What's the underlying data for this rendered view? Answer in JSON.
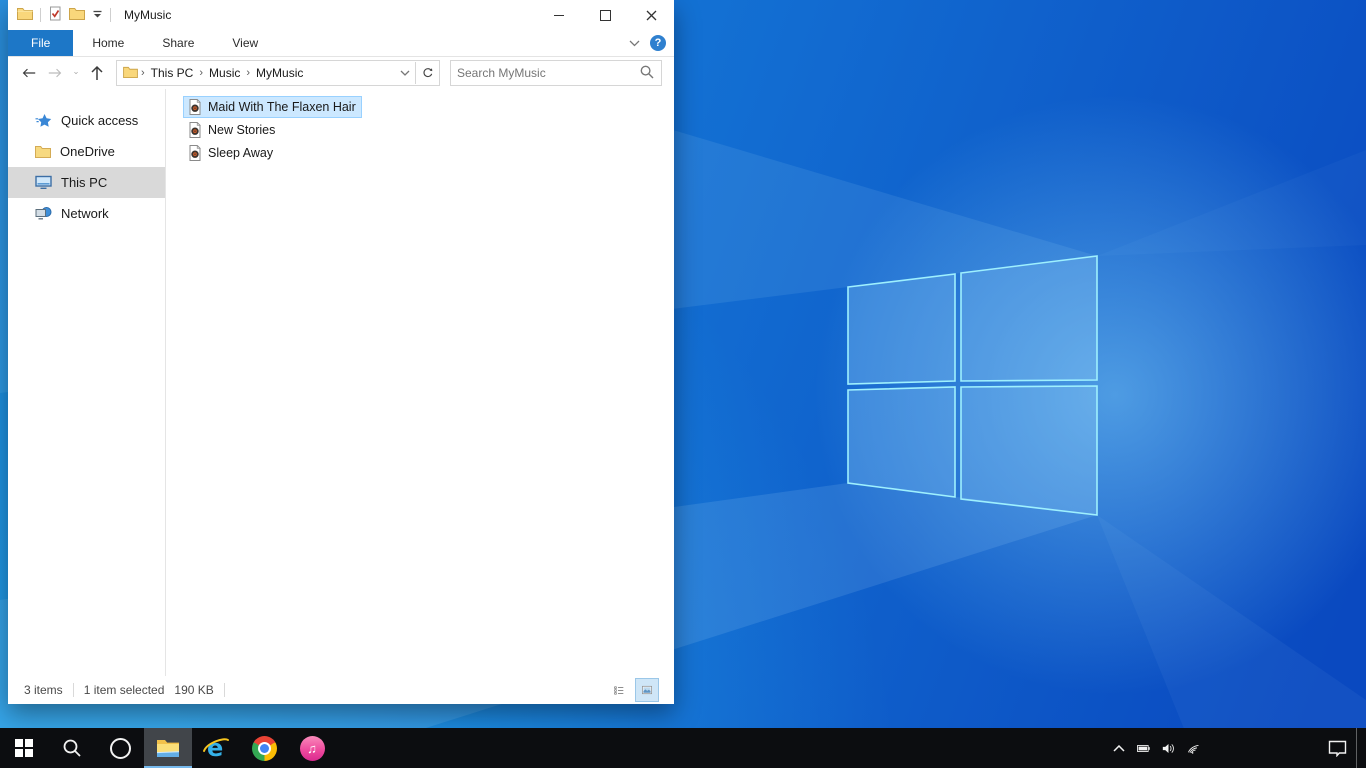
{
  "window": {
    "title": "MyMusic",
    "quick_access_toolbar": {
      "icons": [
        "explorer-folder",
        "properties",
        "new-folder",
        "customize-dropdown"
      ]
    },
    "caption_controls": [
      "minimize",
      "maximize",
      "close"
    ],
    "tabs": [
      {
        "label": "File",
        "active": true
      },
      {
        "label": "Home",
        "active": false
      },
      {
        "label": "Share",
        "active": false
      },
      {
        "label": "View",
        "active": false
      }
    ],
    "ribbon": {
      "collapse_icon": "chevron-down",
      "help_label": "?"
    },
    "address": {
      "crumbs": [
        "This PC",
        "Music",
        "MyMusic"
      ],
      "separator": "›",
      "icons": [
        "back",
        "forward",
        "recent-locations-dropdown",
        "up",
        "folder",
        "address-dropdown",
        "refresh"
      ]
    },
    "search": {
      "placeholder": "Search MyMusic",
      "icon": "magnifier"
    },
    "nav_items": [
      {
        "label": "Quick access",
        "icon": "quick-access-star",
        "selected": false
      },
      {
        "label": "OneDrive",
        "icon": "folder",
        "selected": false
      },
      {
        "label": "This PC",
        "icon": "this-pc-monitor",
        "selected": true
      },
      {
        "label": "Network",
        "icon": "network-computer",
        "selected": false
      }
    ],
    "files": [
      {
        "name": "Maid With The Flaxen Hair",
        "icon": "music-file",
        "selected": true
      },
      {
        "name": "New Stories",
        "icon": "music-file",
        "selected": false
      },
      {
        "name": "Sleep Away",
        "icon": "music-file",
        "selected": false
      }
    ],
    "status": {
      "item_count": "3 items",
      "selected_info": "1 item selected",
      "selected_size": "190 KB",
      "view_toggles": [
        "details-view",
        "large-thumbnails-view"
      ]
    }
  },
  "taskbar": {
    "buttons": [
      {
        "name": "start"
      },
      {
        "name": "search"
      },
      {
        "name": "cortana"
      },
      {
        "name": "file-explorer",
        "active": true
      },
      {
        "name": "internet-explorer"
      },
      {
        "name": "chrome"
      },
      {
        "name": "itunes"
      }
    ],
    "tray_icons": [
      "hidden-icons-chevron",
      "battery",
      "volume",
      "wifi"
    ],
    "action_center": "action-center",
    "show_desktop": "show-desktop"
  },
  "desktop": {
    "wallpaper": "windows-10-light-logo"
  },
  "colors": {
    "accent_blue": "#1d77c7",
    "selection_fill": "#cce8ff",
    "selection_border": "#99d1ff",
    "nav_selected_gray": "#d9d9d9",
    "taskbar_bg": "#0c0d10",
    "taskbar_active_underline": "#76b9ed",
    "wallpaper_left": "#1e8fe2",
    "wallpaper_right": "#0a49c0"
  }
}
